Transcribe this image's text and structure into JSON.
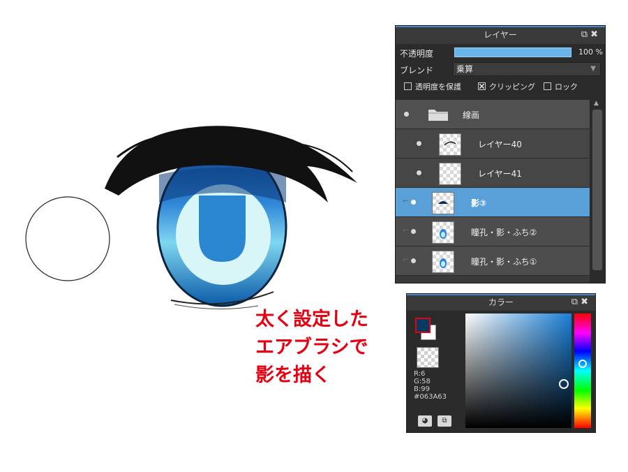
{
  "annotations": {
    "caption_lines": [
      "太く設定した",
      "エアブラシで",
      "影を描く"
    ],
    "blend_callout": "乗算"
  },
  "layer_panel": {
    "title": "レイヤー",
    "opacity_label": "不透明度",
    "opacity_value": "100 %",
    "opacity_percent": 100,
    "blend_label": "ブレンド",
    "blend_value": "乗算",
    "protect_alpha_label": "透明度を保護",
    "clipping_label": "クリッピング",
    "clipping_checked": true,
    "lock_label": "ロック",
    "layers": [
      {
        "name": "線画",
        "type": "folder"
      },
      {
        "name": "レイヤー40",
        "type": "child",
        "thumb": "stroke"
      },
      {
        "name": "レイヤー41",
        "type": "child",
        "thumb": "empty"
      },
      {
        "name": "影③",
        "type": "clipped",
        "active": true,
        "thumb": "shadow"
      },
      {
        "name": "瞳孔・影・ふち②",
        "type": "clipped",
        "thumb": "eye"
      },
      {
        "name": "瞳孔・影・ふち①",
        "type": "clipped",
        "thumb": "eye"
      }
    ]
  },
  "color_panel": {
    "title": "カラー",
    "primary_color": "#063A63",
    "secondary_color": "#FFFFFF",
    "r": "R:6",
    "g": "G:58",
    "b": "B:99",
    "hex": "#063A63"
  },
  "colors": {
    "accent_red": "#e60012",
    "active_layer": "#5aa0d8",
    "opacity_bar": "#6ab4ec"
  }
}
